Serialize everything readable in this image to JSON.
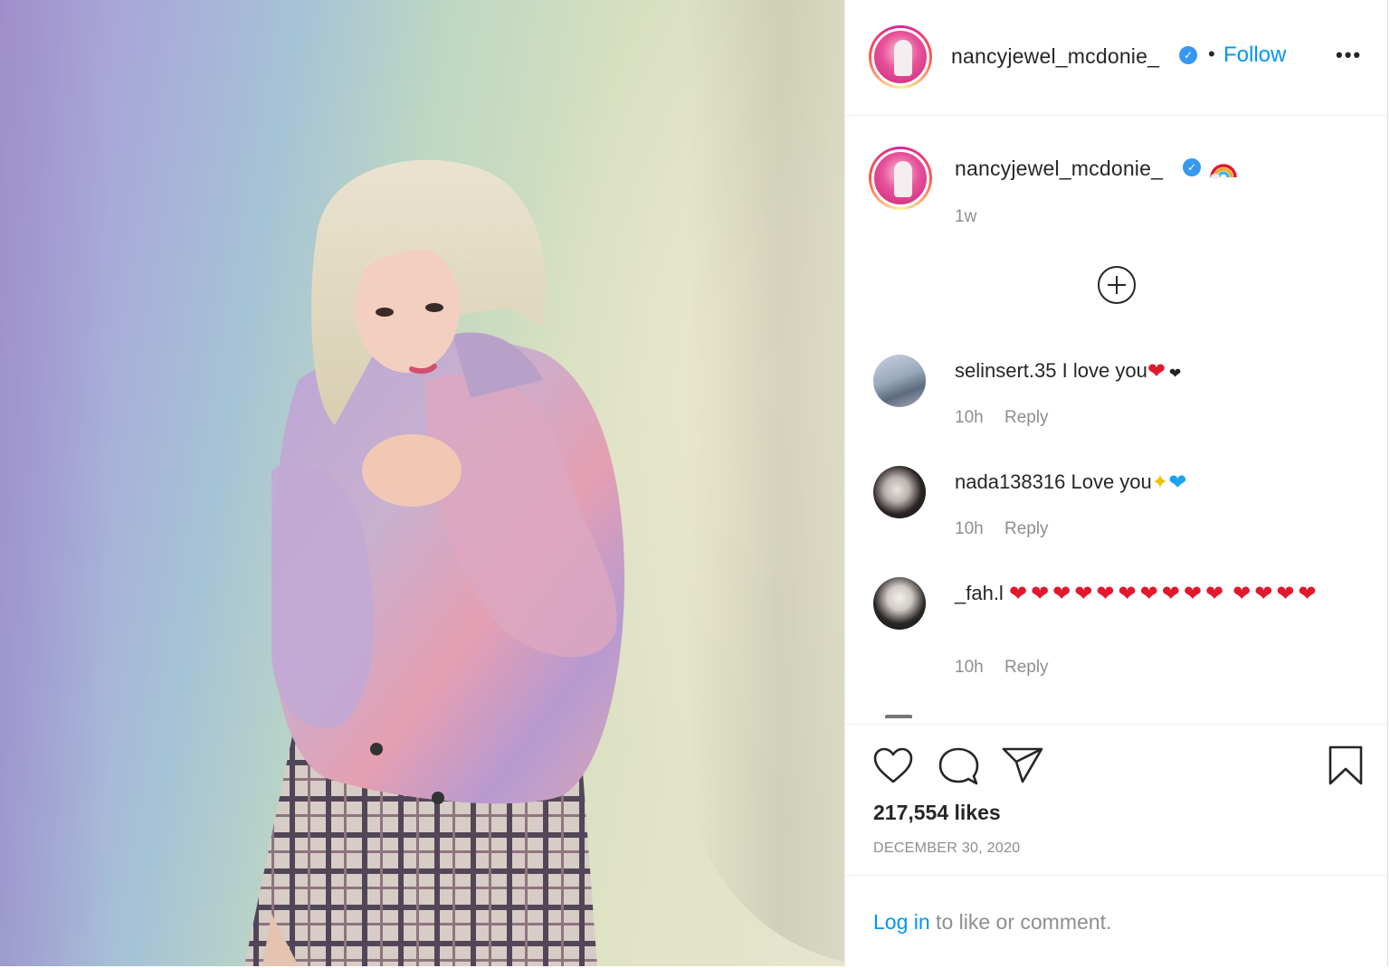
{
  "post": {
    "author": "nancyjewel_mcdonie_",
    "follow_label": "Follow",
    "dot": "•",
    "more_label": "•••",
    "verified_mark": "✓"
  },
  "caption": {
    "author": "nancyjewel_mcdonie_",
    "emoji": "rainbow",
    "time": "1w"
  },
  "comments": [
    {
      "user": "selinsert.35",
      "text": "I love you",
      "time": "10h",
      "reply": "Reply"
    },
    {
      "user": "nada138316",
      "text": "Love you",
      "time": "10h",
      "reply": "Reply"
    },
    {
      "user": "_fah.l",
      "text": "",
      "time": "10h",
      "reply": "Reply"
    }
  ],
  "stats": {
    "likes": "217,554 likes",
    "date": "DECEMBER 30, 2020"
  },
  "footer": {
    "login_link": "Log in",
    "login_rest": " to like or comment."
  },
  "colors": {
    "link_blue": "#0095f6",
    "verified_blue": "#3897f0",
    "heart_red": "#e0192d",
    "muted_text": "#8e8e8e"
  }
}
